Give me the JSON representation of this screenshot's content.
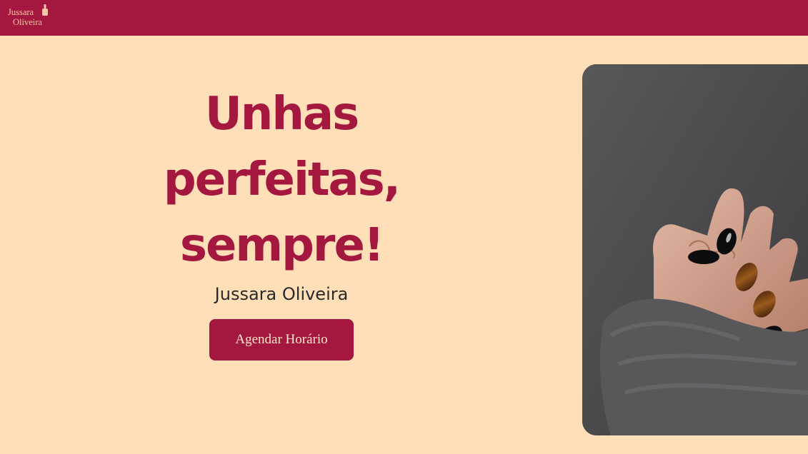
{
  "brand": {
    "logo_line1": "Jussara",
    "logo_line2": "Oliveira",
    "logo_icon": "nail-polish-icon"
  },
  "hero": {
    "title": "Unhas\nperfeitas,\nsempre!",
    "subtitle": "Jussara Oliveira",
    "cta_label": "Agendar Horário"
  },
  "image": {
    "subject": "hand-with-painted-nails-photo"
  },
  "colors": {
    "primary": "#A4173F",
    "background": "#FFDFB7",
    "logo_text": "#F7C8A3",
    "button_text": "#FFE6C8"
  }
}
